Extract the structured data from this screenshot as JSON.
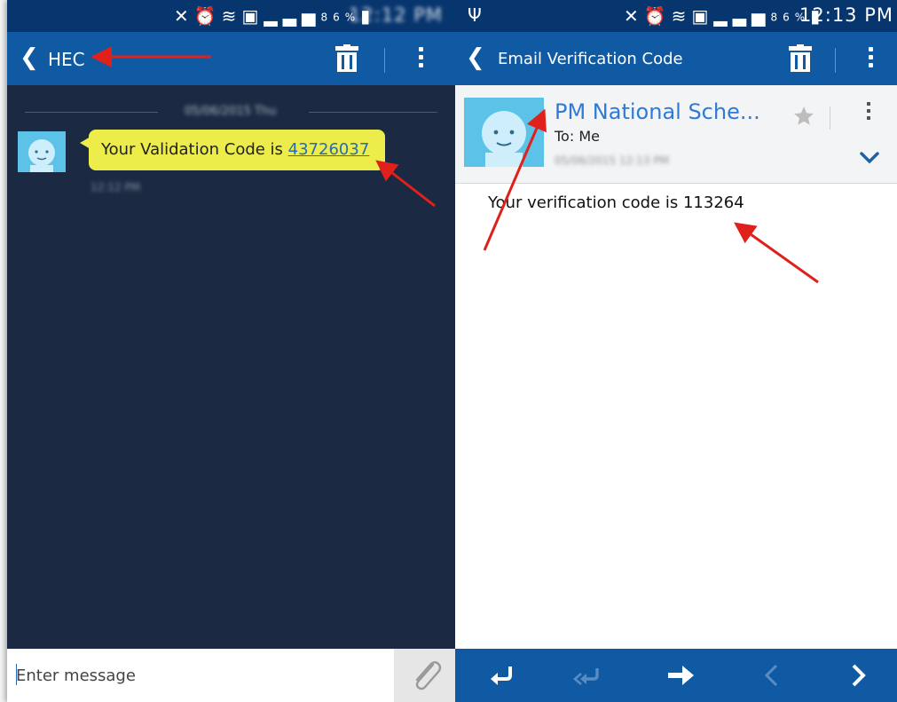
{
  "left": {
    "status": {
      "battery_pct": "86%",
      "time": "12:12 PM"
    },
    "toolbar": {
      "title": "HEC"
    },
    "thread": {
      "date_divider": "05/06/2015 Thu",
      "message": {
        "prefix": "Your Validation Code is ",
        "code": "43726037",
        "time": "12:12 PM"
      }
    },
    "compose": {
      "placeholder": "Enter message"
    }
  },
  "right": {
    "status": {
      "battery_pct": "86%",
      "time": "12:13 PM"
    },
    "toolbar": {
      "title": "Email Verification Code"
    },
    "email": {
      "sender": "PM National Sche...",
      "to_line": "To: Me",
      "date": "05/06/2015 12:13 PM",
      "body": "Your verification code is 113264"
    }
  },
  "icons": {
    "status": [
      "usb-icon",
      "mute-icon",
      "alarm-icon",
      "wifi-icon",
      "sim-icon",
      "signal-icon",
      "battery-icon"
    ],
    "toolbar": [
      "back-icon",
      "trash-icon",
      "more-icon"
    ],
    "email_bottom": [
      "reply-icon",
      "reply-all-icon",
      "forward-icon",
      "previous-icon",
      "next-icon"
    ]
  },
  "colors": {
    "status_bar": "#07356e",
    "toolbar": "#0f5aa3",
    "conversation_bg": "#1b2a42",
    "bubble": "#ecec4a",
    "link": "#2a6ab3",
    "sender_name": "#2f7ad6",
    "annotation_arrow": "#e0201b"
  }
}
